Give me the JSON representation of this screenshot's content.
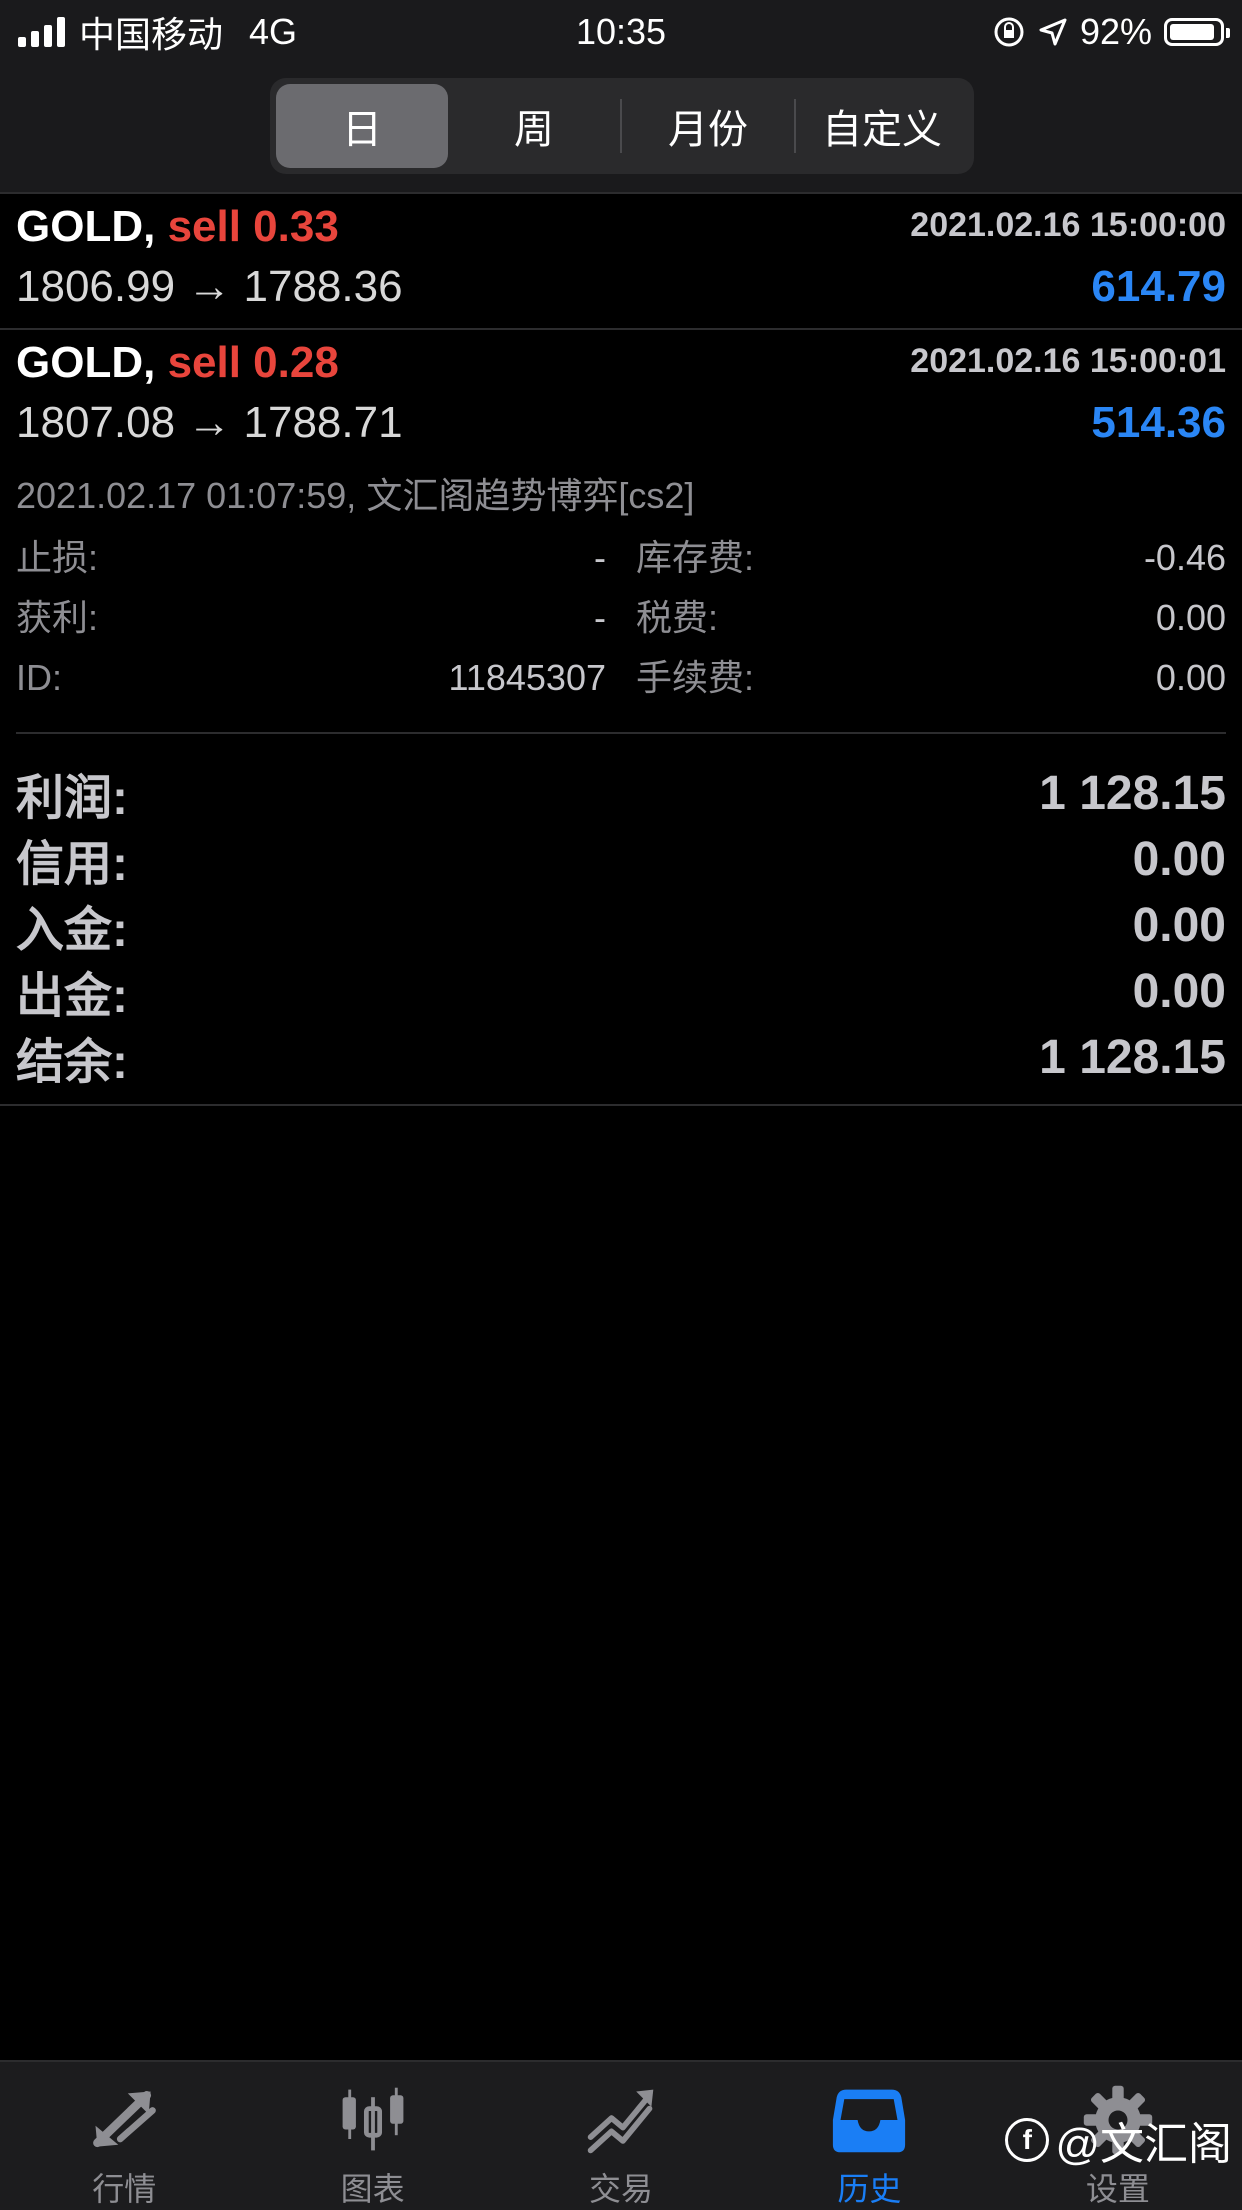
{
  "status_bar": {
    "carrier": "中国移动",
    "network": "4G",
    "time": "10:35",
    "battery": "92%",
    "battery_level": 0.92
  },
  "segments": {
    "items": [
      "日",
      "周",
      "月份",
      "自定义"
    ],
    "active_index": 0
  },
  "trades": [
    {
      "symbol": "GOLD,",
      "side": "sell 0.33",
      "time": "2021.02.16 15:00:00",
      "prices": "1806.99 → 1788.36",
      "profit": "614.79"
    },
    {
      "symbol": "GOLD,",
      "side": "sell 0.28",
      "time": "2021.02.16 15:00:01",
      "prices": "1807.08 → 1788.71",
      "profit": "514.36",
      "comment": "2021.02.17 01:07:59, 文汇阁趋势博弈[cs2]",
      "details": {
        "stop_loss_label": "止损:",
        "stop_loss": "-",
        "swap_label": "库存费:",
        "swap": "-0.46",
        "take_profit_label": "获利:",
        "take_profit": "-",
        "tax_label": "税费:",
        "tax": "0.00",
        "id_label": "ID:",
        "id": "11845307",
        "commission_label": "手续费:",
        "commission": "0.00"
      }
    }
  ],
  "summary": [
    {
      "label": "利润:",
      "value": "1 128.15"
    },
    {
      "label": "信用:",
      "value": "0.00"
    },
    {
      "label": "入金:",
      "value": "0.00"
    },
    {
      "label": "出金:",
      "value": "0.00"
    },
    {
      "label": "结余:",
      "value": "1 128.15"
    }
  ],
  "tabbar": {
    "items": [
      {
        "label": "行情",
        "icon": "quotes-arrows-icon"
      },
      {
        "label": "图表",
        "icon": "candlestick-chart-icon"
      },
      {
        "label": "交易",
        "icon": "trade-line-icon"
      },
      {
        "label": "历史",
        "icon": "history-inbox-icon"
      },
      {
        "label": "设置",
        "icon": "gear-icon"
      }
    ],
    "active_index": 3
  },
  "watermark": "@文汇阁",
  "colors": {
    "sell": "#e8453c",
    "profit": "#2a86f5",
    "active_tab": "#1a7ef5"
  }
}
